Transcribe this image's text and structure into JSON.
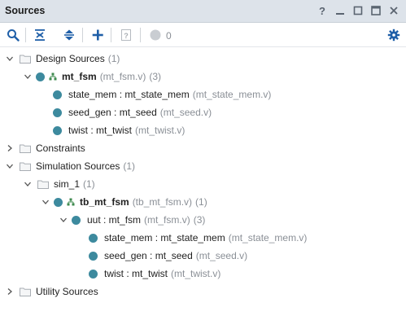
{
  "window": {
    "title": "Sources",
    "controls": {
      "help": "?",
      "minimize": "—",
      "restore": "☐",
      "maximize": "⬜",
      "close": "✕"
    }
  },
  "toolbar": {
    "items": [
      "search-icon",
      "collapse-all-icon",
      "expand-all-icon",
      "add-icon",
      "unknown-file-icon",
      "status-dot-icon",
      "gear-icon"
    ],
    "status_count": "0"
  },
  "tree": {
    "design_sources": {
      "label": "Design Sources",
      "count": "(1)",
      "top": {
        "name": "mt_fsm",
        "file": "(mt_fsm.v)",
        "count": "(3)",
        "children": [
          {
            "name": "state_mem : mt_state_mem",
            "file": "(mt_state_mem.v)"
          },
          {
            "name": "seed_gen : mt_seed",
            "file": "(mt_seed.v)"
          },
          {
            "name": "twist : mt_twist",
            "file": "(mt_twist.v)"
          }
        ]
      }
    },
    "constraints": {
      "label": "Constraints"
    },
    "simulation_sources": {
      "label": "Simulation Sources",
      "count": "(1)",
      "sim": {
        "label": "sim_1",
        "count": "(1)",
        "top": {
          "name": "tb_mt_fsm",
          "file": "(tb_mt_fsm.v)",
          "count": "(1)",
          "uut": {
            "name": "uut : mt_fsm",
            "file": "(mt_fsm.v)",
            "count": "(3)",
            "children": [
              {
                "name": "state_mem : mt_state_mem",
                "file": "(mt_state_mem.v)"
              },
              {
                "name": "seed_gen : mt_seed",
                "file": "(mt_seed.v)"
              },
              {
                "name": "twist : mt_twist",
                "file": "(mt_twist.v)"
              }
            ]
          }
        }
      }
    },
    "utility_sources": {
      "label": "Utility Sources"
    }
  },
  "colors": {
    "titlebar": "#dde3ea",
    "module_dot": "#3d8a9e",
    "accent": "#1f5fa8",
    "muted_text": "#8a8f96"
  }
}
